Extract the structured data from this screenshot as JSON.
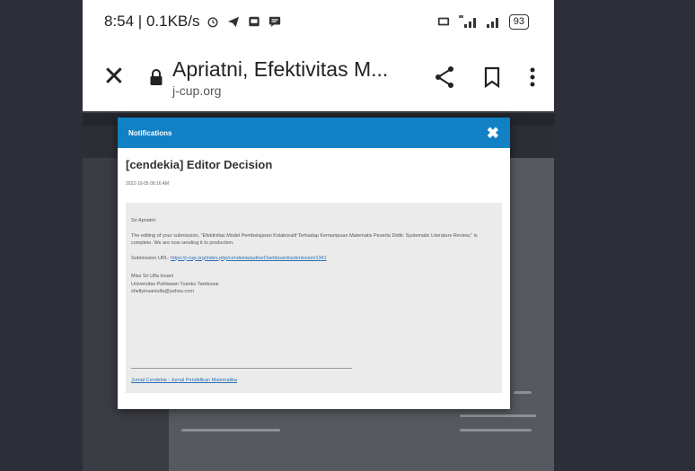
{
  "status_bar": {
    "time_speed": "8:54 | 0.1KB/s",
    "battery": "93"
  },
  "browser": {
    "page_title": "Apriatni, Efektivitas M...",
    "domain": "j-cup.org"
  },
  "notification": {
    "header_title": "Notifications",
    "subject": "[cendekia] Editor Decision",
    "date": "2022-10-05 09:16 AM",
    "greeting": "Sri Apriatni:",
    "body": "The editing of your submission, \"Efektivitas Model Pembelajaran Kolaboratif Terhadap Kemampuan Matematis Peserta Didik: Systematic Literature Review,\" is complete. We are now sending it to production.",
    "submission_label": "Submission URL:",
    "submission_url": "https://j-cup.org/index.php/cendekia/authorDashboard/submission/1341",
    "sign_name": "Miss Sri Ulfa Insani",
    "sign_org": "Universitas Pahlawan Tuanku Tambusai",
    "sign_email": "shellyinsaniulfa@yahoo.com",
    "footer_link": "Jurnal Cendekia : Jurnal Pendidikan Matematika"
  }
}
